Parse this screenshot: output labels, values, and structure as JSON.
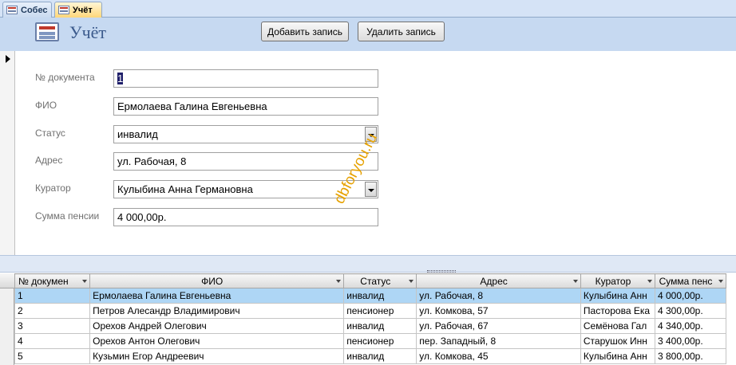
{
  "tabs": [
    {
      "label": "Собес"
    },
    {
      "label": "Учёт"
    }
  ],
  "form": {
    "title": "Учёт",
    "add_button": "Добавить запись",
    "delete_button": "Удалить запись"
  },
  "fields": {
    "doc_number": {
      "label": "№ документа",
      "value": "1"
    },
    "fio": {
      "label": "ФИО",
      "value": "Ермолаева Галина Евгеньевна"
    },
    "status": {
      "label": "Статус",
      "value": "инвалид"
    },
    "address": {
      "label": "Адрес",
      "value": "ул. Рабочая, 8"
    },
    "curator": {
      "label": "Куратор",
      "value": "Кулыбина Анна Германовна"
    },
    "pension": {
      "label": "Сумма пенсии",
      "value": "4 000,00р."
    }
  },
  "watermark": "dbforyou.ru",
  "grid": {
    "columns": [
      "№ докумен",
      "ФИО",
      "Статус",
      "Адрес",
      "Куратор",
      "Сумма пенс"
    ],
    "rows": [
      [
        "1",
        "Ермолаева Галина Евгеньевна",
        "инвалид",
        "ул. Рабочая, 8",
        "Кулыбина Анн",
        "4 000,00р."
      ],
      [
        "2",
        "Петров Алесандр Владимирович",
        "пенсионер",
        "ул. Комкова, 57",
        "Пасторова Ека",
        "4 300,00р."
      ],
      [
        "3",
        "Орехов Андрей Олегович",
        "инвалид",
        "ул. Рабочая, 67",
        "Семёнова Гал",
        "4 340,00р."
      ],
      [
        "4",
        "Орехов Антон Олегович",
        "пенсионер",
        "пер. Западный, 8",
        "Старушок Инн",
        "3 400,00р."
      ],
      [
        "5",
        "Кузьмин Егор Андреевич",
        "инвалид",
        "ул. Комкова, 45",
        "Кулыбина Анн",
        "3 800,00р."
      ]
    ]
  },
  "colors": {
    "header_bg": "#c6d9f1",
    "title_color": "#3b5a8c",
    "selected_row": "#aed6f5",
    "watermark": "#e6a100"
  }
}
